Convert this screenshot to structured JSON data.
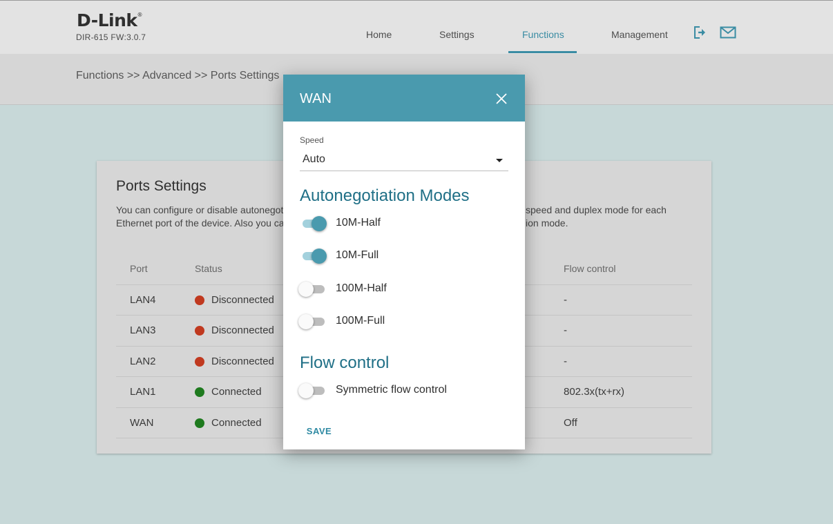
{
  "header": {
    "logo": "D-Link",
    "logo_mark": "®",
    "model": "DIR-615 FW:3.0.7",
    "nav": [
      "Home",
      "Settings",
      "Functions",
      "Management"
    ],
    "active_nav": "Functions",
    "icons": [
      "logout-icon",
      "mail-icon"
    ],
    "accent": "#3a8ca3"
  },
  "breadcrumb": "Functions >> Advanced >> Ports Settings",
  "page": {
    "title": "Ports Settings",
    "desc_line1_left": "You can configure or disable autonegot",
    "desc_line1_right": "speed and duplex mode for each",
    "desc_line2_left": "Ethernet port of the device. Also you ca",
    "desc_line2_right": "ion mode.",
    "columns": {
      "port": "Port",
      "status": "Status",
      "flow": "Flow control"
    },
    "rows": [
      {
        "port": "LAN4",
        "status": "Disconnected",
        "status_color": "#c0391f",
        "flow": "-"
      },
      {
        "port": "LAN3",
        "status": "Disconnected",
        "status_color": "#c0391f",
        "flow": "-"
      },
      {
        "port": "LAN2",
        "status": "Disconnected",
        "status_color": "#c0391f",
        "flow": "-"
      },
      {
        "port": "LAN1",
        "status": "Connected",
        "status_color": "#1e7a1e",
        "flow": "802.3x(tx+rx)"
      },
      {
        "port": "WAN",
        "status": "Connected",
        "status_color": "#1e7a1e",
        "flow": "Off"
      }
    ]
  },
  "modal": {
    "title": "WAN",
    "speed_label": "Speed",
    "speed_value": "Auto",
    "autoneg_title": "Autonegotiation Modes",
    "modes": [
      {
        "label": "10M-Half",
        "on": true
      },
      {
        "label": "10M-Full",
        "on": true
      },
      {
        "label": "100M-Half",
        "on": false
      },
      {
        "label": "100M-Full",
        "on": false
      }
    ],
    "flow_title": "Flow control",
    "flow_toggle": {
      "label": "Symmetric flow control",
      "on": false
    },
    "save": "SAVE",
    "header_color": "#4a9aae"
  }
}
